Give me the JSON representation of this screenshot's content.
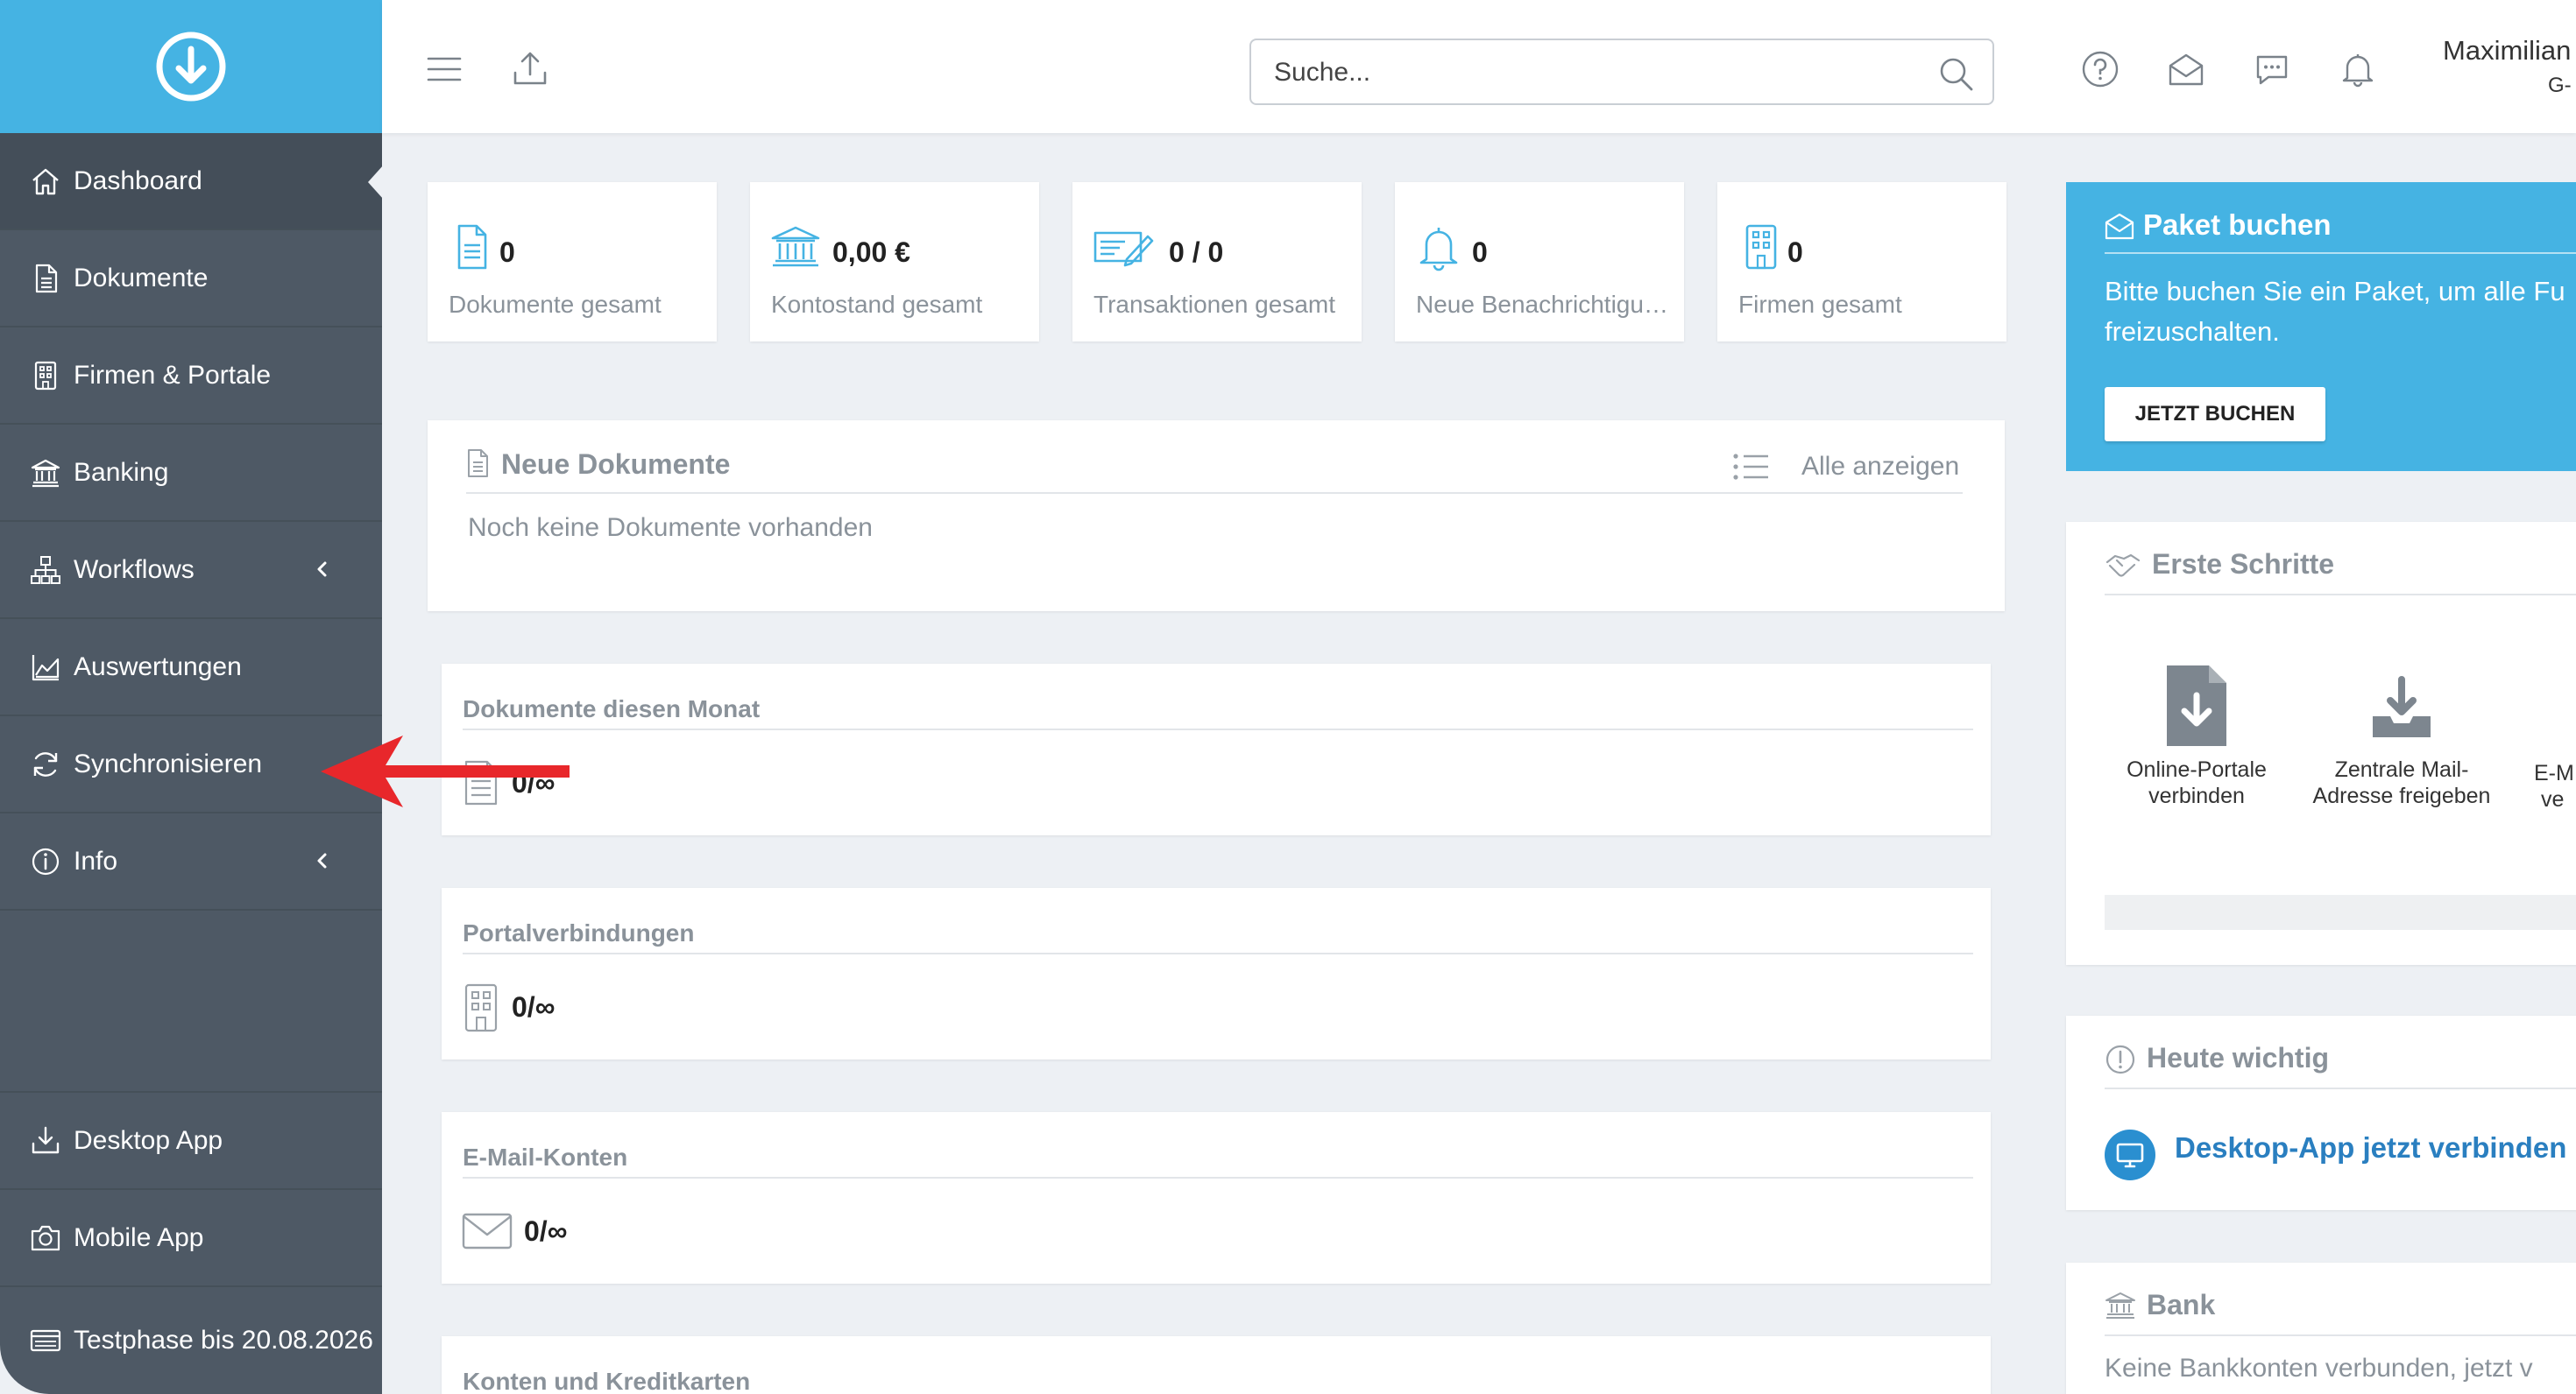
{
  "app": {
    "brand_icon": "download-circle-icon",
    "brand_color": "#45b3e3",
    "sidebar_color": "#4e5965"
  },
  "sidebar": {
    "items": [
      {
        "label": "Dashboard",
        "icon": "home-icon"
      },
      {
        "label": "Dokumente",
        "icon": "document-icon"
      },
      {
        "label": "Firmen & Portale",
        "icon": "building-icon"
      },
      {
        "label": "Banking",
        "icon": "bank-icon"
      },
      {
        "label": "Workflows",
        "icon": "workflow-icon"
      },
      {
        "label": "Auswertungen",
        "icon": "chart-area-icon"
      },
      {
        "label": "Synchronisieren",
        "icon": "sync-icon"
      },
      {
        "label": "Info",
        "icon": "info-icon"
      }
    ],
    "bottom": [
      {
        "label": "Desktop App",
        "icon": "download-tray-icon"
      },
      {
        "label": "Mobile App",
        "icon": "camera-icon"
      },
      {
        "label": "Testphase bis 20.08.2026",
        "icon": "credit-card-icon"
      }
    ]
  },
  "header": {
    "search_placeholder": "Suche...",
    "user_name": "Maximilian",
    "user_sub": "G-"
  },
  "stats": [
    {
      "value": "0",
      "label": "Dokumente gesamt",
      "icon": "document-icon"
    },
    {
      "value": "0,00 €",
      "label": "Kontostand gesamt",
      "icon": "bank-icon"
    },
    {
      "value": "0 / 0",
      "label": "Transaktionen gesamt",
      "icon": "check-edit-icon"
    },
    {
      "value": "0",
      "label": "Neue Benachrichtigungen",
      "icon": "bell-icon"
    },
    {
      "value": "0",
      "label": "Firmen gesamt",
      "icon": "building-icon"
    }
  ],
  "neue_dokumente": {
    "title": "Neue Dokumente",
    "link": "Alle anzeigen",
    "empty": "Noch keine Dokumente vorhanden"
  },
  "limits": [
    {
      "title": "Dokumente diesen Monat",
      "value": "0/∞",
      "icon": "document-icon"
    },
    {
      "title": "Portalverbindungen",
      "value": "0/∞",
      "icon": "building-icon"
    },
    {
      "title": "E-Mail-Konten",
      "value": "0/∞",
      "icon": "mail-icon"
    },
    {
      "title": "Konten und Kreditkarten"
    }
  ],
  "promo": {
    "title": "Paket buchen",
    "text_line1": "Bitte buchen Sie ein Paket, um alle Fu",
    "text_line2": "freizuschalten.",
    "button": "JETZT BUCHEN"
  },
  "erste_schritte": {
    "title": "Erste Schritte",
    "steps": [
      {
        "line1": "Online-Portale",
        "line2": "verbinden"
      },
      {
        "line1": "Zentrale Mail-",
        "line2": "Adresse freigeben"
      },
      {
        "line1": "E-M",
        "line2": "ve"
      }
    ]
  },
  "heute_wichtig": {
    "title": "Heute wichtig",
    "cta": "Desktop-App jetzt verbinden"
  },
  "bank": {
    "title": "Bank",
    "text": "Keine Bankkonten verbunden, jetzt v"
  }
}
